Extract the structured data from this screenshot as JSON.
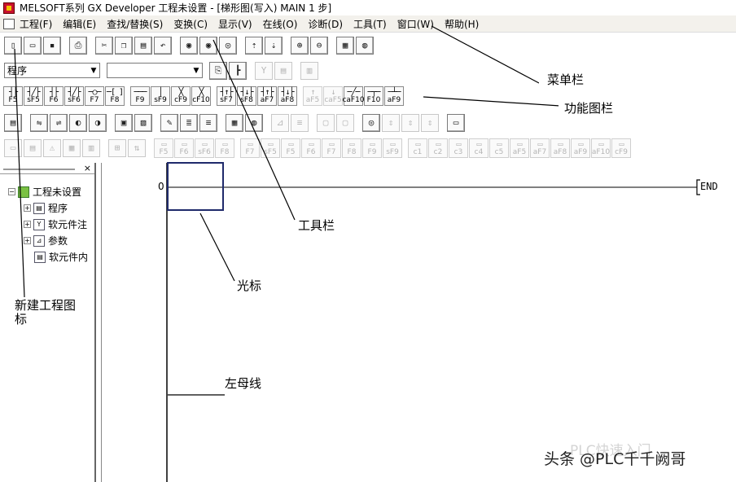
{
  "window": {
    "title": "MELSOFT系列 GX Developer 工程未设置 - [梯形图(写入)     MAIN     1 步]"
  },
  "menu": [
    "工程(F)",
    "编辑(E)",
    "查找/替换(S)",
    "变换(C)",
    "显示(V)",
    "在线(O)",
    "诊断(D)",
    "工具(T)",
    "窗口(W)",
    "帮助(H)"
  ],
  "toolbar2": {
    "program_select": "程序",
    "second_select": ""
  },
  "fkeys_row1": [
    {
      "sym": "┤├",
      "key": "F5"
    },
    {
      "sym": "┤╱├",
      "key": "sF5"
    },
    {
      "sym": "┤├",
      "key": "F6"
    },
    {
      "sym": "┤╱├",
      "key": "sF6"
    },
    {
      "sym": "─○─",
      "key": "F7"
    },
    {
      "sym": "─[ ]",
      "key": "F8"
    },
    {
      "sym": "───",
      "key": "F9"
    },
    {
      "sym": " │ ",
      "key": "sF9"
    },
    {
      "sym": " ╳ ",
      "key": "cF9"
    },
    {
      "sym": " ╳ ",
      "key": "cF10"
    },
    {
      "sym": "┤↑├",
      "key": "sF7"
    },
    {
      "sym": "┤↓├",
      "key": "sF8"
    },
    {
      "sym": "┤↑├",
      "key": "aF7"
    },
    {
      "sym": "┤↓├",
      "key": "aF8"
    },
    {
      "sym": " ↑ ",
      "key": "aF5"
    },
    {
      "sym": " ↓ ",
      "key": "caF5"
    },
    {
      "sym": "─╱─",
      "key": "caF10"
    },
    {
      "sym": "─┬─",
      "key": "F10"
    },
    {
      "sym": "─┴─",
      "key": "aF9"
    }
  ],
  "fkeys_row2": [
    "F5",
    "F6",
    "sF6",
    "F8",
    "F7",
    "sF5",
    "F5",
    "F6",
    "F7",
    "F8",
    "F9",
    "sF9",
    "c1",
    "c2",
    "c3",
    "c4",
    "c5",
    "aF5",
    "aF7",
    "aF8",
    "aF9",
    "aF10",
    "cF9"
  ],
  "sidebar": {
    "close": "×",
    "root": "工程未设置",
    "items": [
      "程序",
      "软元件注",
      "参数",
      "软元件内"
    ]
  },
  "ladder": {
    "step_number": "0",
    "end_label": "END"
  },
  "annotations": {
    "menubar": "菜单栏",
    "function_toolbar": "功能图栏",
    "toolbar": "工具栏",
    "cursor": "光标",
    "new_project_icon": "新建工程图\n标",
    "left_bus": "左母线"
  },
  "watermark": {
    "text": "头条 @PLC千千阙哥",
    "faded": "PLC快速入门"
  }
}
